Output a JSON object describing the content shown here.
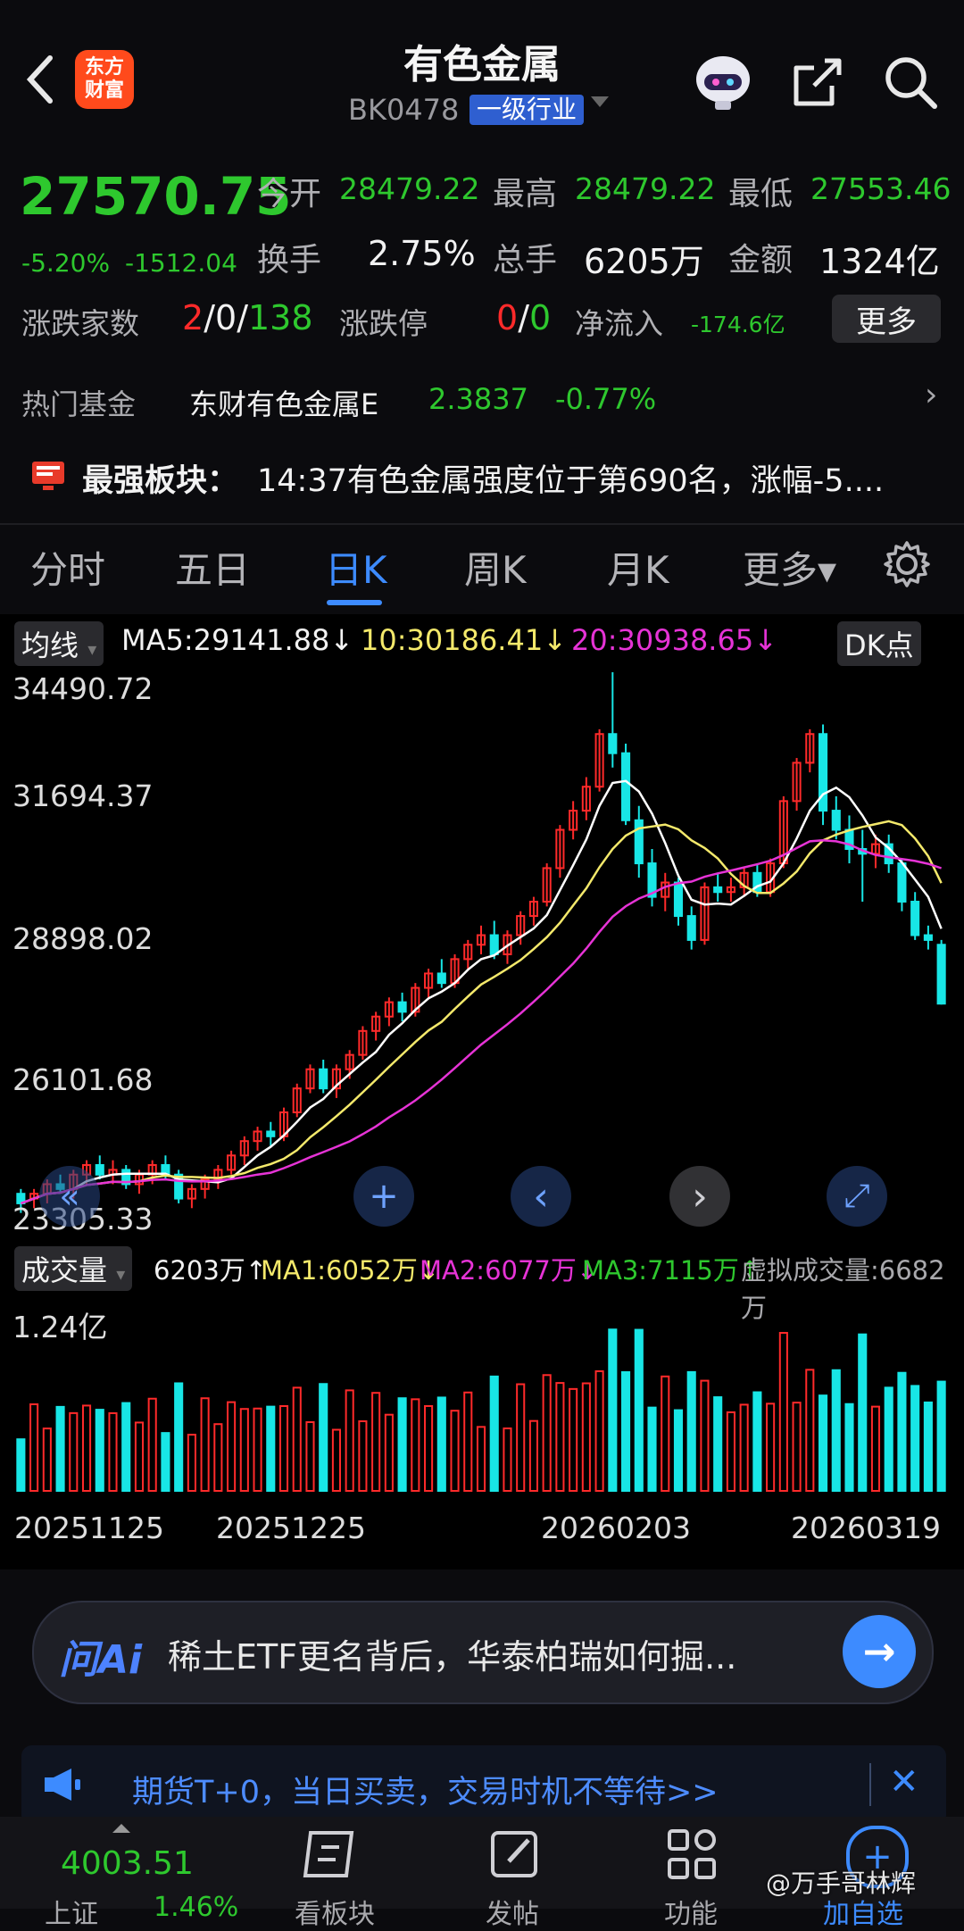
{
  "header": {
    "back_label": "‹",
    "logo_line1": "东方",
    "logo_line2": "财富",
    "title": "有色金属",
    "code": "BK0478",
    "industry_tag": "一级行业"
  },
  "quote": {
    "price": "27570.75",
    "change_pct": "-5.20%",
    "change_abs": "-1512.04",
    "open_label": "今开",
    "open": "28479.22",
    "high_label": "最高",
    "high": "28479.22",
    "low_label": "最低",
    "low": "27553.46",
    "turnover_label": "换手",
    "turnover": "2.75%",
    "volume_label": "总手",
    "volume": "6205万",
    "amount_label": "金额",
    "amount": "1324亿",
    "breadth_label": "涨跌家数",
    "breadth_up": "2",
    "breadth_sep1": "/",
    "breadth_flat": "0",
    "breadth_sep2": "/",
    "breadth_down": "138",
    "limit_label": "涨跌停",
    "limit_up": "0",
    "limit_sep": "/",
    "limit_down": "0",
    "netflow_label": "净流入",
    "netflow": "-174.6亿",
    "more_button": "更多"
  },
  "fund": {
    "label": "热门基金",
    "name": "东财有色金属E",
    "nav": "2.3837",
    "change": "-0.77%",
    "arrow": "›"
  },
  "news": {
    "prefix": "最强板块：",
    "text": "14:37有色金属强度位于第690名，涨幅-5...."
  },
  "tabs": [
    "分时",
    "五日",
    "日K",
    "周K",
    "月K",
    "更多▾"
  ],
  "active_tab": 2,
  "ma_bar": {
    "selector": "均线",
    "ma5": "MA5:29141.88↓",
    "ma10": "10:30186.41↓",
    "ma20": "20:30938.65↓",
    "dk_button": "DK点"
  },
  "price_axis": [
    "34490.72",
    "31694.37",
    "28898.02",
    "26101.68",
    "23305.33"
  ],
  "volume_bar": {
    "selector": "成交量",
    "vol": "6203万↑",
    "ma1": "MA1:6052万↓",
    "ma2": "MA2:6077万↓",
    "ma3": "MA3:7115万↑",
    "virtual": "虚拟成交量:6682万"
  },
  "volume_axis_top": "1.24亿",
  "dates": [
    "20251125",
    "20251225",
    "20260203",
    "20260319"
  ],
  "chart_controls": [
    "«",
    "+",
    "‹",
    "›",
    "⤢"
  ],
  "ai": {
    "logo": "问Ai",
    "text": "稀土ETF更名背后，华泰柏瑞如何掘...",
    "go": "→"
  },
  "ad": {
    "text": "期货T+0，当日买卖，交易时机不等待>>",
    "close": "✕"
  },
  "bottom": {
    "index_value": "4003.51",
    "index_name": "上证",
    "index_change": "1.46%",
    "items": [
      "看板块",
      "发帖",
      "功能",
      "加自选"
    ]
  },
  "watermark": "@万手哥林辉",
  "colors": {
    "up": "#ff2a2a",
    "down": "#18e6e6",
    "accent": "#3d8bff",
    "ma5": "#ffffff",
    "ma10": "#f4e96b",
    "ma20": "#e633d6"
  },
  "chart_data": {
    "type": "candlestick",
    "y_range": [
      23305.33,
      34490.72
    ],
    "ohlc_approx": [
      [
        23600,
        23700,
        23200,
        23400
      ],
      [
        23500,
        23700,
        23300,
        23600
      ],
      [
        23600,
        23900,
        23400,
        23800
      ],
      [
        23800,
        24000,
        23600,
        23700
      ],
      [
        23700,
        24100,
        23500,
        24000
      ],
      [
        24000,
        24300,
        23800,
        24200
      ],
      [
        24200,
        24400,
        23900,
        24000
      ],
      [
        24000,
        24300,
        23800,
        24100
      ],
      [
        24100,
        24200,
        23700,
        23800
      ],
      [
        23800,
        24100,
        23600,
        24000
      ],
      [
        24000,
        24300,
        23800,
        24200
      ],
      [
        24200,
        24400,
        23900,
        24000
      ],
      [
        24000,
        24100,
        23400,
        23500
      ],
      [
        23500,
        23800,
        23300,
        23700
      ],
      [
        23700,
        24000,
        23500,
        23900
      ],
      [
        23900,
        24200,
        23700,
        24100
      ],
      [
        24100,
        24500,
        24000,
        24400
      ],
      [
        24400,
        24800,
        24200,
        24700
      ],
      [
        24700,
        25000,
        24500,
        24900
      ],
      [
        24900,
        25100,
        24600,
        24800
      ],
      [
        24800,
        25400,
        24700,
        25300
      ],
      [
        25300,
        25900,
        25200,
        25800
      ],
      [
        25800,
        26300,
        25700,
        26200
      ],
      [
        26200,
        26400,
        25700,
        25800
      ],
      [
        25800,
        26300,
        25600,
        26200
      ],
      [
        26200,
        26600,
        26000,
        26500
      ],
      [
        26500,
        27100,
        26400,
        27000
      ],
      [
        27000,
        27400,
        26800,
        27300
      ],
      [
        27300,
        27700,
        27100,
        27600
      ],
      [
        27600,
        27800,
        27200,
        27400
      ],
      [
        27400,
        28000,
        27300,
        27900
      ],
      [
        27900,
        28300,
        27700,
        28200
      ],
      [
        28200,
        28500,
        27900,
        28000
      ],
      [
        28000,
        28600,
        27900,
        28500
      ],
      [
        28500,
        28900,
        28300,
        28800
      ],
      [
        28800,
        29200,
        28600,
        29000
      ],
      [
        29000,
        29300,
        28500,
        28600
      ],
      [
        28600,
        29100,
        28400,
        29000
      ],
      [
        29000,
        29500,
        28800,
        29400
      ],
      [
        29400,
        29800,
        29200,
        29700
      ],
      [
        29700,
        30500,
        29600,
        30400
      ],
      [
        30400,
        31300,
        30200,
        31200
      ],
      [
        31200,
        31800,
        31000,
        31600
      ],
      [
        31600,
        32300,
        31400,
        32100
      ],
      [
        32100,
        33300,
        32000,
        33200
      ],
      [
        33200,
        34490,
        32500,
        32800
      ],
      [
        32800,
        33000,
        31300,
        31400
      ],
      [
        31400,
        31700,
        30200,
        30500
      ],
      [
        30500,
        30800,
        29600,
        29800
      ],
      [
        29800,
        30300,
        29500,
        30100
      ],
      [
        30100,
        30200,
        29200,
        29400
      ],
      [
        29400,
        29600,
        28700,
        28900
      ],
      [
        28900,
        30100,
        28800,
        30000
      ],
      [
        30000,
        30300,
        29700,
        29900
      ],
      [
        29900,
        30200,
        29700,
        30000
      ],
      [
        30000,
        30400,
        29800,
        30300
      ],
      [
        30300,
        30500,
        29800,
        29900
      ],
      [
        29900,
        30600,
        29800,
        30500
      ],
      [
        30500,
        31900,
        30400,
        31800
      ],
      [
        31800,
        32700,
        31600,
        32600
      ],
      [
        32600,
        33300,
        32400,
        33200
      ],
      [
        33200,
        33400,
        31300,
        31600
      ],
      [
        31600,
        31900,
        31000,
        31200
      ],
      [
        31200,
        31500,
        30500,
        30800
      ],
      [
        30800,
        31200,
        29700,
        30700
      ],
      [
        30700,
        31100,
        30400,
        30900
      ],
      [
        30900,
        31100,
        30300,
        30500
      ],
      [
        30500,
        30600,
        29500,
        29700
      ],
      [
        29700,
        29900,
        28900,
        29000
      ],
      [
        29000,
        29200,
        28700,
        28900
      ],
      [
        28800,
        28900,
        27550,
        27570
      ]
    ]
  }
}
